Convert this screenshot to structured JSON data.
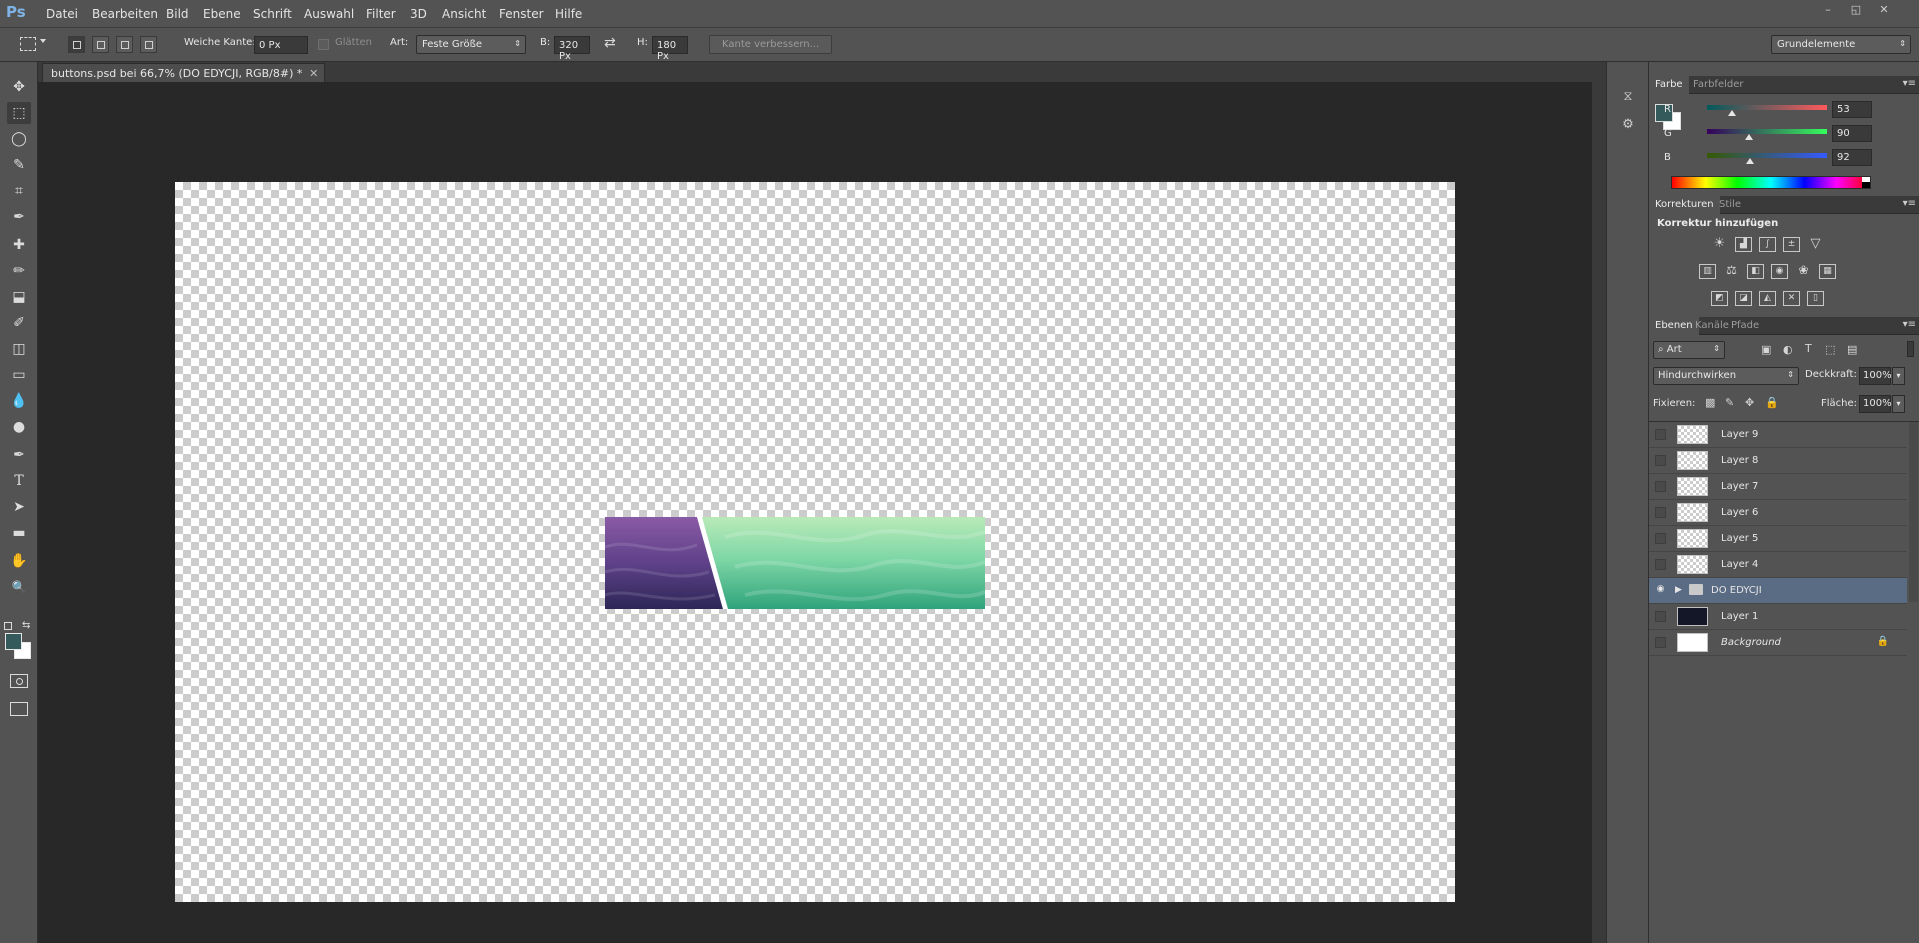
{
  "app": {
    "logo": "Ps"
  },
  "menu": [
    "Datei",
    "Bearbeiten",
    "Bild",
    "Ebene",
    "Schrift",
    "Auswahl",
    "Filter",
    "3D",
    "Ansicht",
    "Fenster",
    "Hilfe"
  ],
  "window_controls": {
    "minimize": "–",
    "restore": "◱",
    "close": "✕"
  },
  "options": {
    "feather_label": "Weiche Kante:",
    "feather_value": "0 Px",
    "antialias_label": "Glätten",
    "style_label": "Art:",
    "style_value": "Feste Größe",
    "width_label": "B:",
    "width_value": "320 Px",
    "swap_icon": "⇄",
    "height_label": "H:",
    "height_value": "180 Px",
    "refine_edge": "Kante verbessern...",
    "workspace": "Grundelemente"
  },
  "document_tab": {
    "title": "buttons.psd bei 66,7% (DO EDYCJI, RGB/8#) *",
    "close": "✕"
  },
  "tools": [
    "move-tool",
    "marquee-tool",
    "lasso-tool",
    "quick-select-tool",
    "crop-tool",
    "eyedropper-tool",
    "healing-brush-tool",
    "brush-tool",
    "clone-stamp-tool",
    "history-brush-tool",
    "eraser-tool",
    "gradient-tool",
    "blur-tool",
    "dodge-tool",
    "pen-tool",
    "type-tool",
    "path-select-tool",
    "shape-tool",
    "hand-tool",
    "zoom-tool"
  ],
  "tool_glyphs": [
    "✥",
    "⬚",
    "◯",
    "✎",
    "⌗",
    "✒",
    "✚",
    "✏",
    "⬓",
    "✐",
    "◫",
    "▭",
    "💧",
    "●",
    "✒",
    "T",
    "➤",
    "▬",
    "✋",
    "🔍"
  ],
  "colors": {
    "foreground": "#355a5c",
    "background": "#ffffff",
    "accent": "#5a6b84"
  },
  "color_panel": {
    "tabs": [
      "Farbe",
      "Farbfelder"
    ],
    "channels": [
      {
        "label": "R",
        "value": "53",
        "level": 0.208
      },
      {
        "label": "G",
        "value": "90",
        "level": 0.353
      },
      {
        "label": "B",
        "value": "92",
        "level": 0.361
      }
    ]
  },
  "adjustments_panel": {
    "tabs": [
      "Korrekturen",
      "Stile"
    ],
    "heading": "Korrektur hinzufügen",
    "icons": [
      "brightness-contrast-icon",
      "levels-icon",
      "curves-icon",
      "exposure-icon",
      "vibrance-icon",
      "hue-saturation-icon",
      "color-balance-icon",
      "black-white-icon",
      "photo-filter-icon",
      "channel-mixer-icon",
      "color-lookup-icon",
      "invert-icon",
      "posterize-icon",
      "threshold-icon",
      "gradient-map-icon",
      "selective-color-icon"
    ]
  },
  "layers_panel": {
    "tabs": [
      "Ebenen",
      "Kanäle",
      "Pfade"
    ],
    "filter_kind": "Art",
    "blend_mode": "Hindurchwirken",
    "opacity_label": "Deckkraft:",
    "opacity_value": "100%",
    "lock_label": "Fixieren:",
    "fill_label": "Fläche:",
    "fill_value": "100%",
    "layers": [
      {
        "name": "Layer 9",
        "visible": false,
        "type": "pixel"
      },
      {
        "name": "Layer 8",
        "visible": false,
        "type": "pixel"
      },
      {
        "name": "Layer 7",
        "visible": false,
        "type": "pixel"
      },
      {
        "name": "Layer 6",
        "visible": false,
        "type": "pixel"
      },
      {
        "name": "Layer 5",
        "visible": false,
        "type": "pixel"
      },
      {
        "name": "Layer 4",
        "visible": false,
        "type": "pixel"
      },
      {
        "name": "DO EDYCJI",
        "visible": true,
        "type": "group",
        "selected": true
      },
      {
        "name": "Layer 1",
        "visible": false,
        "type": "dark"
      },
      {
        "name": "Background",
        "visible": false,
        "type": "white",
        "locked": true
      }
    ]
  }
}
